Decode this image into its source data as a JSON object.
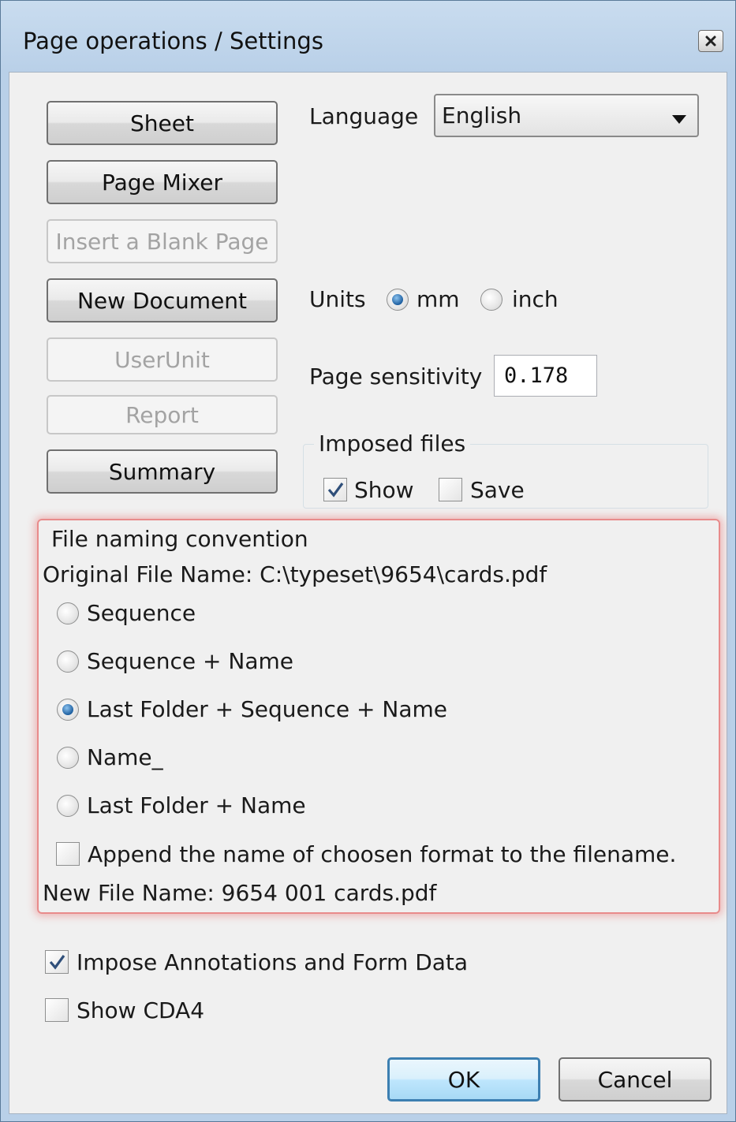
{
  "window": {
    "title": "Page operations / Settings",
    "close_icon": "close-icon"
  },
  "buttons": {
    "sheet": "Sheet",
    "page_mixer": "Page Mixer",
    "insert_blank": "Insert a Blank Page",
    "new_document": "New Document",
    "userunit": "UserUnit",
    "report": "Report",
    "summary": "Summary",
    "ok": "OK",
    "cancel": "Cancel"
  },
  "language": {
    "label": "Language",
    "selected": "English"
  },
  "units": {
    "label": "Units",
    "options": [
      "mm",
      "inch"
    ],
    "selected": "mm"
  },
  "sensitivity": {
    "label": "Page sensitivity",
    "value": "0.178"
  },
  "imposed_files": {
    "title": "Imposed files",
    "show_label": "Show",
    "show_checked": true,
    "save_label": "Save",
    "save_checked": false
  },
  "naming": {
    "title": "File naming convention",
    "original_file_name": "Original File Name: C:\\typeset\\9654\\cards.pdf",
    "options": [
      "Sequence",
      "Sequence  + Name",
      "Last Folder  + Sequence  + Name",
      "Name_",
      "Last Folder  + Name"
    ],
    "selected_index": 2,
    "append_label": "Append the name of choosen format to the filename.",
    "append_checked": false,
    "new_file_name": "New File Name: 9654 001 cards.pdf"
  },
  "options": {
    "impose_annotations_label": "Impose Annotations and Form Data",
    "impose_annotations_checked": true,
    "show_cda4_label": "Show CDA4",
    "show_cda4_checked": false
  },
  "colors": {
    "title_bar": "#c9dcef",
    "dialog_bg": "#f0f0f0",
    "highlight_border": "#e88b8b",
    "radio_selected": "#1d5fa0"
  }
}
